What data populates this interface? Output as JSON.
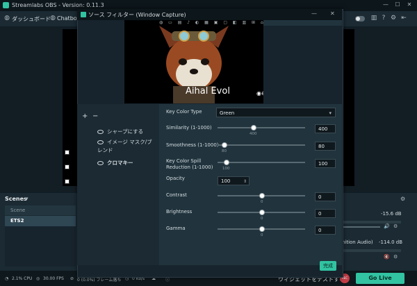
{
  "app": {
    "title": "Streamlabs OBS - Version: 0.11.3"
  },
  "window_controls": {
    "minimize": "—",
    "maximize": "☐",
    "close": "✕"
  },
  "topbar": {
    "dashboard_label": "ダッシュボード",
    "chatbot_label": "Chatbot"
  },
  "dialog": {
    "title": "ソース フィルター (Window Capture)",
    "preview_text": "Aihal Evol",
    "toolbar_glyphs": "◍ ▭ ▤ ♪ ◐ ▦ ▣ ▢ ◧ ▥ ⊞ ⌂",
    "add_label": "+",
    "remove_label": "−",
    "filters": [
      "シャープにする",
      "イメージ マスク/ブレンド",
      "クロマキー"
    ],
    "active_filter": "クロマキー",
    "key_color_type_label": "Key Color Type",
    "key_color_value": "Green",
    "params": [
      {
        "label": "Similarity (1-1000)",
        "tick": "400",
        "value": "400",
        "fraction": 0.4
      },
      {
        "label": "Smoothness (1-1000)",
        "tick": "80",
        "value": "80",
        "fraction": 0.08
      },
      {
        "label": "Key Color Spill Reduction (1-1000)",
        "tick": "100",
        "value": "100",
        "fraction": 0.1
      }
    ],
    "opacity_label": "Opacity",
    "opacity_value": "100",
    "adjust": [
      {
        "label": "Contrast",
        "tick": "0",
        "value": "0",
        "fraction": 0.5
      },
      {
        "label": "Brightness",
        "tick": "0",
        "value": "0",
        "fraction": 0.5
      },
      {
        "label": "Gamma",
        "tick": "0",
        "value": "0",
        "fraction": 0.5
      }
    ],
    "done_label": "完成"
  },
  "scenes": {
    "header": "Scenes",
    "column": "Scene",
    "items": [
      "ETS2"
    ]
  },
  "mixer": {
    "track1_db": "-15.6 dB",
    "track2_name": "inition Audio)",
    "track2_db": "-114.0 dB"
  },
  "status": {
    "cpu": "2.1% CPU",
    "fps": "30.00 FPS",
    "dropped": "0 (0.0%) フレーム落ち",
    "bitrate": "0 kb/s",
    "test_widgets": "ウィジェットをテストする",
    "rec": "REC",
    "go_live": "Go Live"
  },
  "colors": {
    "accent": "#31c3a2",
    "background": "#17242d",
    "record": "#c43c46"
  }
}
